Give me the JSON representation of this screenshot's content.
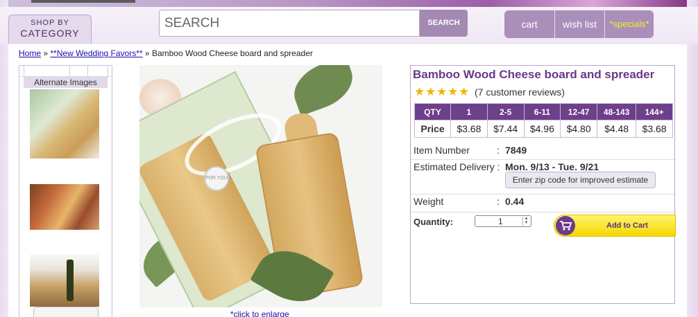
{
  "header": {
    "shop_by_line1": "SHOP BY",
    "shop_by_line2": "CATEGORY",
    "search_placeholder": "SEARCH",
    "search_button": "SEARCH",
    "cart": "cart",
    "wish_list": "wish list",
    "specials": "*specials*"
  },
  "breadcrumb": {
    "home": "Home",
    "sep1": "»",
    "category": "**New Wedding Favors**",
    "sep2": "»",
    "current": "Bamboo Wood Cheese board and spreader"
  },
  "gallery": {
    "alternate_images_label": "Alternate Images",
    "main_tag_text": "FOR YOU",
    "click_to_enlarge": "*click to enlarge"
  },
  "product": {
    "title": "Bamboo Wood Cheese board and spreader",
    "rating_stars": 5,
    "reviews": "(7 customer reviews)",
    "price_table": {
      "qty_label": "QTY",
      "price_label": "Price",
      "tiers": [
        "1",
        "2-5",
        "6-11",
        "12-47",
        "48-143",
        "144+"
      ],
      "prices": [
        "$3.68",
        "$7.44",
        "$4.96",
        "$4.80",
        "$4.48",
        "$3.68"
      ]
    },
    "item_number_label": "Item Number",
    "item_number": "7849",
    "delivery_label": "Estimated Delivery :",
    "delivery_value": "Mon. 9/13 - Tue. 9/21",
    "zip_button": "Enter zip code for improved estimate",
    "weight_label": "Weight",
    "weight_value": "0.44",
    "colon": ":",
    "quantity_label": "Quantity:",
    "quantity_value": "1",
    "add_to_cart": "Add to Cart"
  },
  "colors": {
    "accent_purple": "#6e3f8a",
    "title_purple": "#6a3888",
    "star_gold": "#f0b400",
    "add_cart_yellow": "#f3d800",
    "specials_yellow": "#f7f020"
  }
}
